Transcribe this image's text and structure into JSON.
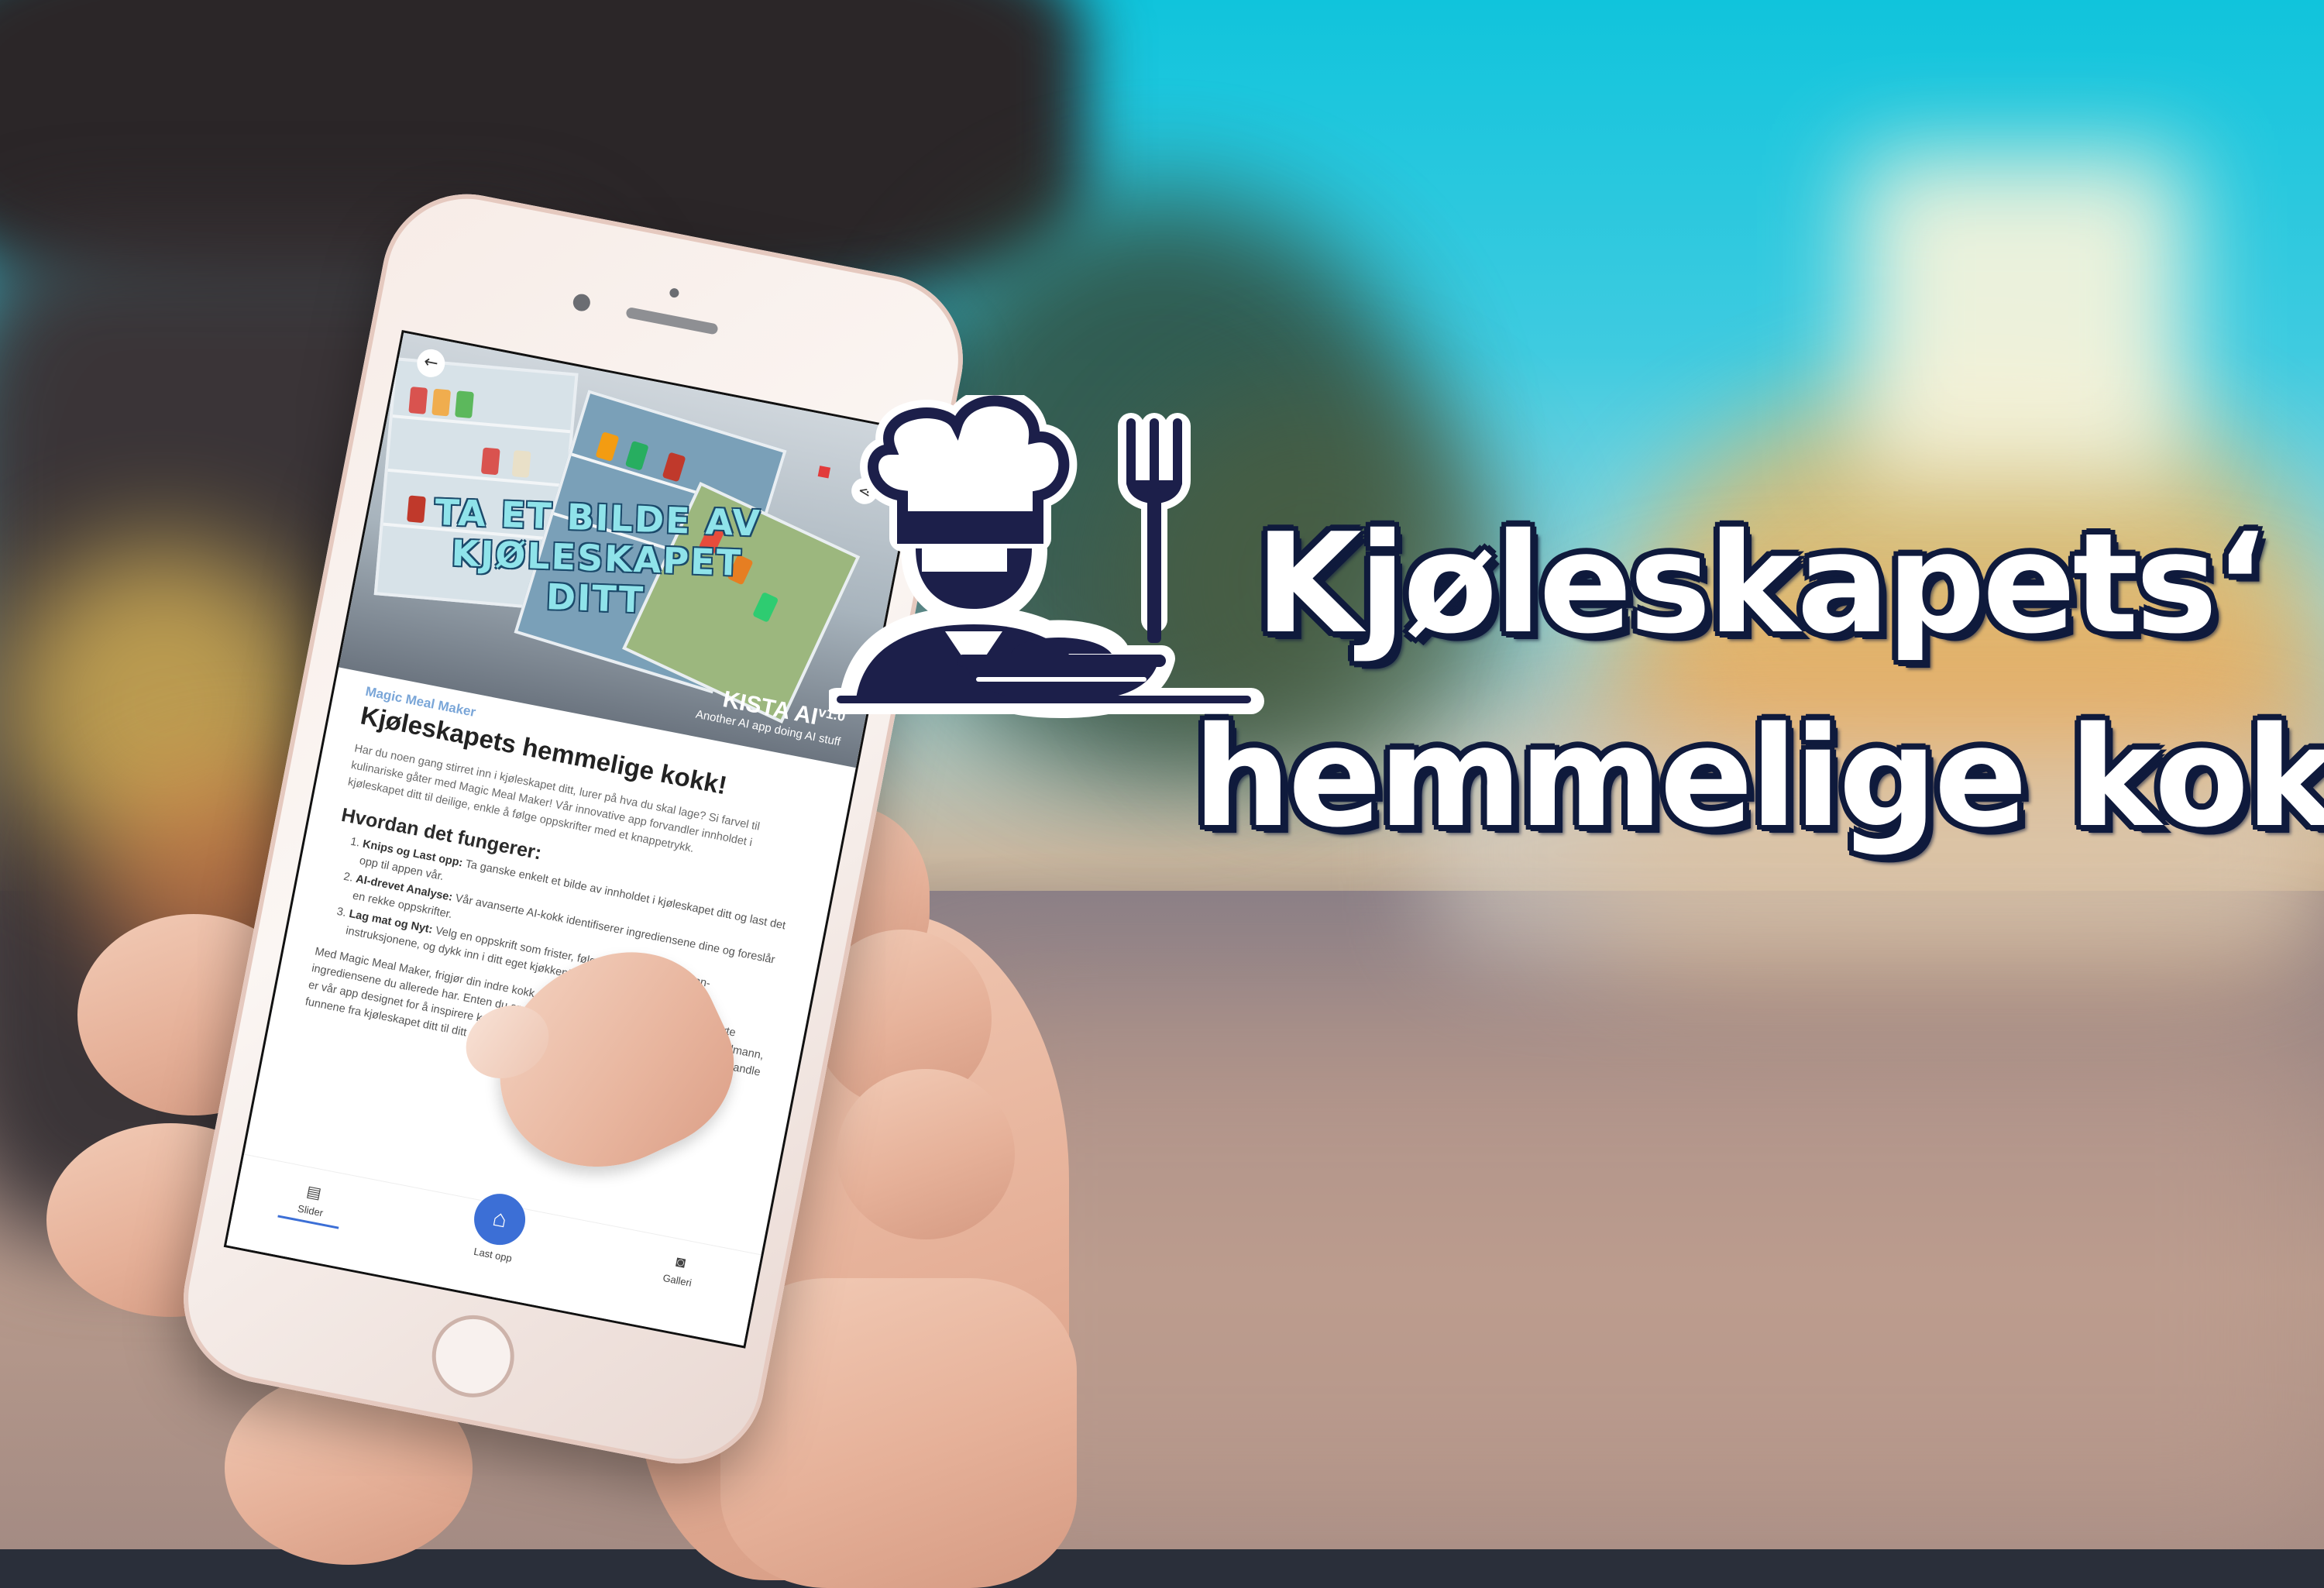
{
  "headline": {
    "line1": "Kjøleskapets‘",
    "line2": "hemmelige kokk"
  },
  "colors": {
    "headline_fill": "#ffffff",
    "headline_outline": "#0f1a3c",
    "chef_icon": "#1c1f4a",
    "accent_blue": "#3c6fd6"
  },
  "app": {
    "hero_title": "TA ET BILDE AV KJØLESKAPET DITT",
    "brand_name": "KISTA AI",
    "brand_version": "v1.0",
    "brand_tagline": "Another AI app doing AI stuff",
    "kicker": "Magic Meal Maker",
    "title": "Kjøleskapets hemmelige kokk!",
    "intro": "Har du noen gang stirret inn i kjøleskapet ditt, lurer på hva du skal lage? Si farvel til kulinariske gåter med Magic Meal Maker! Vår innovative app forvandler innholdet i kjøleskapet ditt til deilige, enkle å følge oppskrifter med et knappetrykk.",
    "how_heading": "Hvordan det fungerer:",
    "steps": [
      {
        "bold": "Knips og Last opp:",
        "text": " Ta ganske enkelt et bilde av innholdet i kjøleskapet ditt og last det opp til appen vår."
      },
      {
        "bold": "AI-drevet Analyse:",
        "text": " Vår avanserte AI-kokk identifiserer ingrediensene dine og foreslår en rekke oppskrifter."
      },
      {
        "bold": "Lag mat og Nyt:",
        "text": " Velg en oppskrift som frister, følg de enkle trinn-for-trinn-instruksjonene, og dykk inn i ditt eget kjøkken!"
      }
    ],
    "outro": "Med Magic Meal Maker, frigjør din indre kokk og oppdag nye, spennende måter å nyte ingrediensene du allerede har. Enten du er en matlagingsnovise eller en kulinarisk trollmann, er vår app designet for å inspirere kreativitet og bringe glede til måltidet ditt. La oss forvandle funnene fra kjøleskapet ditt til ditt neste gastronomiske eventyr!",
    "nav": [
      {
        "label": "Slider",
        "icon": "document-icon"
      },
      {
        "label": "Last opp",
        "icon": "home-icon"
      },
      {
        "label": "Galleri",
        "icon": "camera-icon"
      }
    ]
  }
}
